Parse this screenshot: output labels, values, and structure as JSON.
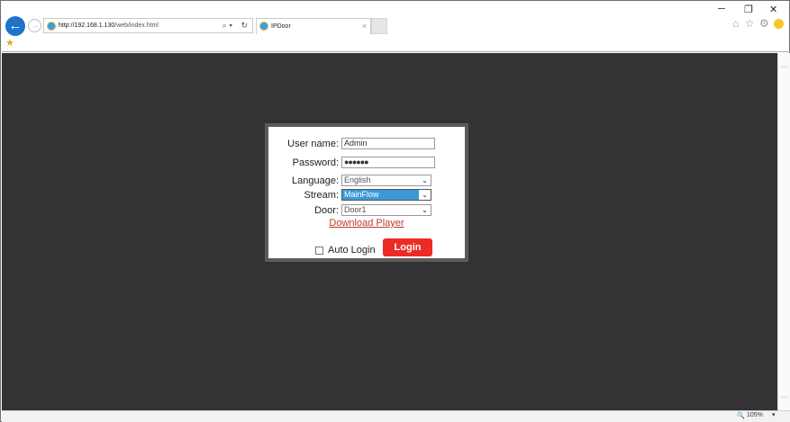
{
  "browser": {
    "url_host": "http://192.168.1.130",
    "url_path": "/web/index.html",
    "tab_title": "IPDoor",
    "zoom": "105%"
  },
  "login": {
    "username_label": "User name:",
    "username_value": "Admin",
    "password_label": "Password:",
    "password_value": "●●●●●●",
    "language_label": "Language:",
    "language_value": "English",
    "stream_label": "Stream:",
    "stream_value": "MainFlow",
    "door_label": "Door:",
    "door_value": "Door1",
    "download_link": "Download Player",
    "auto_login_label": "Auto Login",
    "auto_login_checked": false,
    "login_button": "Login"
  },
  "colors": {
    "accent": "#ee2a24",
    "background": "#333336",
    "link": "#c0392b"
  }
}
